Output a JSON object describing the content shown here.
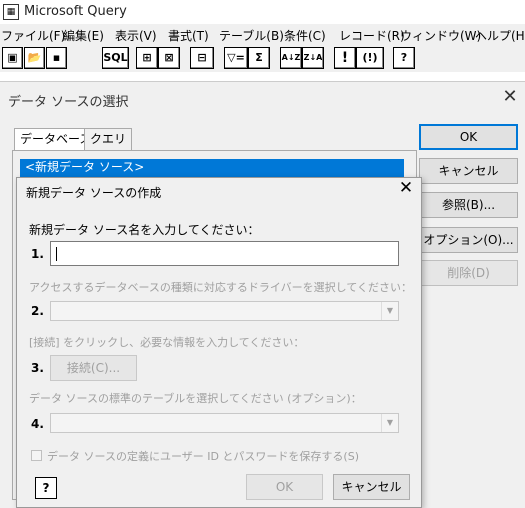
{
  "app": {
    "title": "Microsoft Query",
    "icon": "query-app-icon"
  },
  "menu": [
    "ファイル(F)",
    "編集(E)",
    "表示(V)",
    "書式(T)",
    "テーブル(B)",
    "条件(C)",
    "レコード(R)",
    "ウィンドウ(W)",
    "ヘルプ(H)"
  ],
  "toolbar": {
    "sql": "SQL",
    "filter": "▽=",
    "sum": "Σ",
    "sort_asc": "A↓Z",
    "sort_desc": "Z↓A",
    "run": "!",
    "auto_run": "(!)",
    "help": "?"
  },
  "outer": {
    "title": "データ ソースの選択",
    "tabs": [
      "データベース",
      "クエリ"
    ],
    "selected_source": "<新規データ ソース>",
    "buttons": {
      "ok": "OK",
      "cancel": "キャンセル",
      "browse": "参照(B)...",
      "options": "オプション(O)...",
      "delete": "削除(D)"
    }
  },
  "inner": {
    "title": "新規データ ソースの作成",
    "step1_label": "新規データ ソース名を入力してください：",
    "step1_num": "1.",
    "name_value": "",
    "step2_label": "アクセスするデータベースの種類に対応するドライバーを選択してください：",
    "step2_num": "2.",
    "step3_label": "[接続] をクリックし、必要な情報を入力してください：",
    "step3_num": "3.",
    "connect_button": "接続(C)...",
    "step4_label": "データ ソースの標準のテーブルを選択してください (オプション)：",
    "step4_num": "4.",
    "save_password": "データ ソースの定義にユーザー ID とパスワードを保存する(S)",
    "ok": "OK",
    "cancel": "キャンセル",
    "help": "?"
  },
  "colors": {
    "accent": "#0078d7",
    "disabled_text": "#a0a0a0"
  }
}
